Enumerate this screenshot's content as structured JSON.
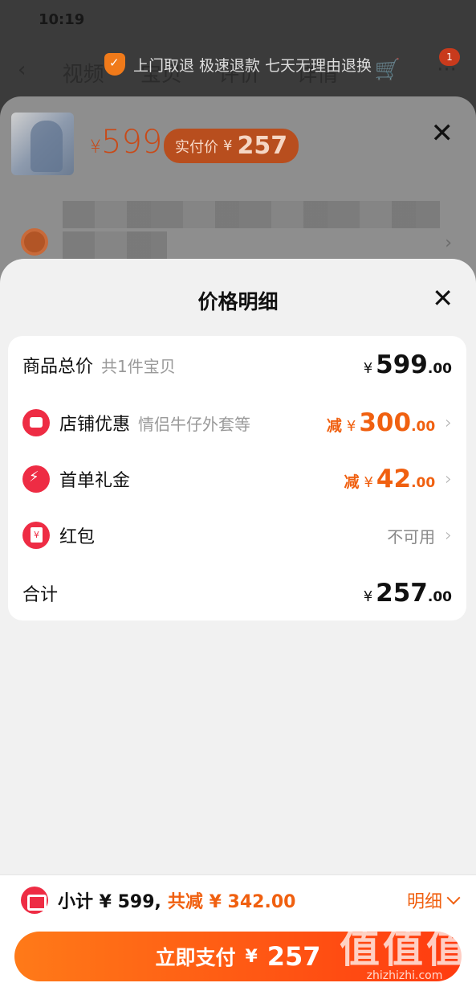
{
  "status": {
    "time": "10:19"
  },
  "promo": {
    "text": "上门取退 极速退款 七天无理由退换"
  },
  "nav": {
    "tabs": [
      "视频",
      "宝贝",
      "评价",
      "详情"
    ]
  },
  "cart_badge": "1",
  "product_sheet": {
    "price_symbol": "¥",
    "price": "599",
    "paid_label": "实付价",
    "paid_symbol": "¥",
    "paid_value": "257"
  },
  "detail_sheet": {
    "title": "价格明细",
    "rows": [
      {
        "label": "商品总价",
        "sub": "共1件宝贝",
        "symbol": "¥",
        "int": "599",
        "dec": ".00"
      },
      {
        "label": "店铺优惠",
        "sub": "情侣牛仔外套等",
        "prefix": "减",
        "symbol": "¥",
        "int": "300",
        "dec": ".00"
      },
      {
        "label": "首单礼金",
        "prefix": "减",
        "symbol": "¥",
        "int": "42",
        "dec": ".00"
      },
      {
        "label": "红包",
        "value": "不可用"
      },
      {
        "label": "合计",
        "symbol": "¥",
        "int": "257",
        "dec": ".00"
      }
    ]
  },
  "bottom": {
    "subtotal": "小计 ¥ 599,",
    "reduction": "共减 ¥ 342.00",
    "detail_link": "明细",
    "pay_label": "立即支付",
    "pay_symbol": "¥",
    "pay_amount": "257"
  },
  "watermark": {
    "main": "值值值",
    "sub": "zhizhizhi.com"
  },
  "colors": {
    "accent": "#f06010",
    "icon_red": "#ee2c44",
    "pay_start": "#ff7a18",
    "pay_end": "#ff3b10"
  }
}
